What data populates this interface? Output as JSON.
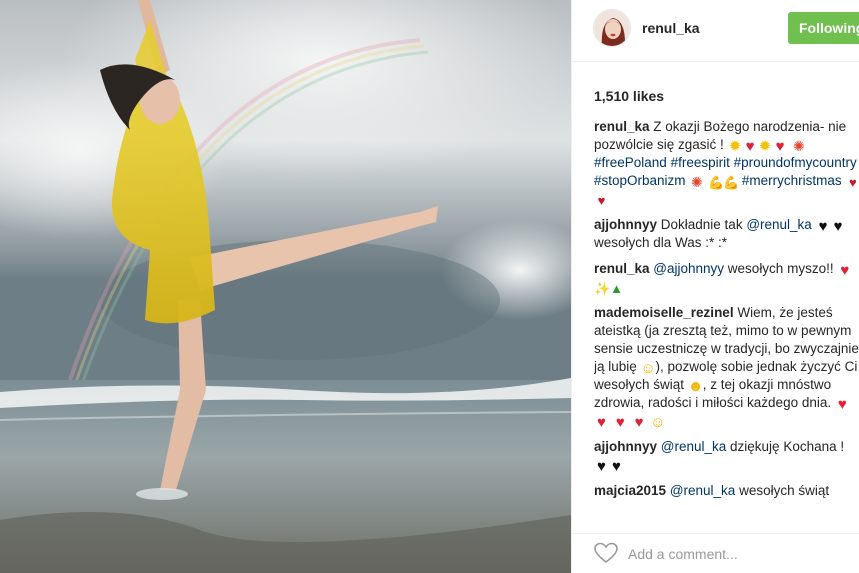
{
  "post": {
    "username": "renul_ka",
    "follow_label": "Following",
    "likes": "1,510 likes"
  },
  "comments": [
    {
      "author": "renul_ka",
      "text1": " Z okazji Bożego narodzenia- nie pozwólcie się zgasić ! ",
      "tags": [
        "#freePoland",
        "#freespirit",
        "#proundofmycountry",
        "#stopOrbanizm",
        "#merrychristmas"
      ]
    },
    {
      "author": "ajjohnnyy",
      "text1": " Dokładnie tak ",
      "mention": "@renul_ka",
      "text2": " wesołych dla Was :* :*"
    },
    {
      "author": "renul_ka",
      "mention": "@ajjohnnyy",
      "text1": " wesołych myszo!!"
    },
    {
      "author": "mademoiselle_rezinel",
      "text1": " Wiem, że jesteś ateistką (ja zresztą też, mimo to w pewnym sensie uczestniczę w tradycji, bo zwyczajnie ją lubię ",
      "text2": "), pozwolę sobie jednak życzyć Ci wesołych świąt ",
      "text3": ", z tej okazji mnóstwo zdrowia, radości i miłości każdego dnia. "
    },
    {
      "author": "ajjohnnyy",
      "mention": "@renul_ka",
      "text1": " dziękuję Kochana ! "
    },
    {
      "author": "majcia2015",
      "mention": "@renul_ka",
      "text1": " wesołych świąt"
    }
  ],
  "footer": {
    "placeholder": "Add a comment..."
  },
  "icons": {
    "like": "heart-outline-icon"
  },
  "colors": {
    "follow_button": "#70c050",
    "link": "#003569",
    "text": "#262626"
  }
}
